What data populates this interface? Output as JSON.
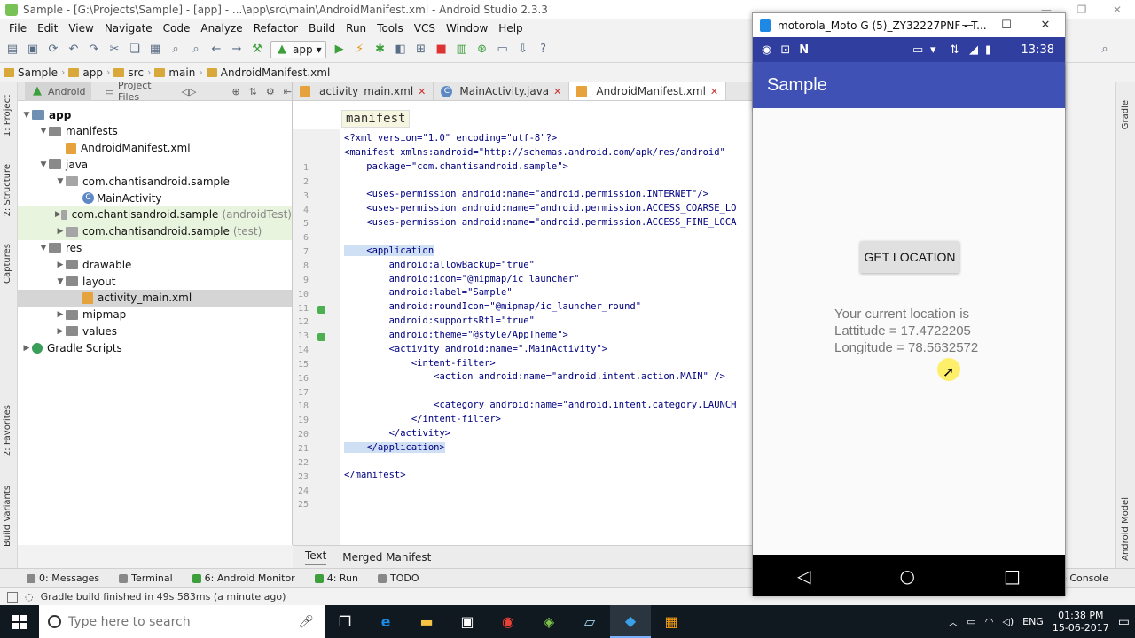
{
  "window": {
    "title": "Sample - [G:\\Projects\\Sample] - [app] - ...\\app\\src\\main\\AndroidManifest.xml - Android Studio 2.3.3"
  },
  "menu": [
    "File",
    "Edit",
    "View",
    "Navigate",
    "Code",
    "Analyze",
    "Refactor",
    "Build",
    "Run",
    "Tools",
    "VCS",
    "Window",
    "Help"
  ],
  "toolbar": {
    "run_config": "app"
  },
  "breadcrumb": [
    "Sample",
    "app",
    "src",
    "main",
    "AndroidManifest.xml"
  ],
  "project_panel": {
    "view_mode": "Android",
    "secondary": "Project Files",
    "tree": [
      {
        "label": "app",
        "level": 0,
        "type": "folder-blue",
        "expanded": true,
        "bold": true
      },
      {
        "label": "manifests",
        "level": 1,
        "type": "folder",
        "expanded": true
      },
      {
        "label": "AndroidManifest.xml",
        "level": 2,
        "type": "xml"
      },
      {
        "label": "java",
        "level": 1,
        "type": "folder",
        "expanded": true
      },
      {
        "label": "com.chantisandroid.sample",
        "level": 2,
        "type": "pkg",
        "expanded": true
      },
      {
        "label": "MainActivity",
        "level": 3,
        "type": "class"
      },
      {
        "label": "com.chantisandroid.sample",
        "suffix": "(androidTest)",
        "level": 2,
        "type": "pkg",
        "expanded": false,
        "hl": true
      },
      {
        "label": "com.chantisandroid.sample",
        "suffix": "(test)",
        "level": 2,
        "type": "pkg",
        "expanded": false,
        "hl": true
      },
      {
        "label": "res",
        "level": 1,
        "type": "folder",
        "expanded": true
      },
      {
        "label": "drawable",
        "level": 2,
        "type": "folder",
        "expanded": false
      },
      {
        "label": "layout",
        "level": 2,
        "type": "folder",
        "expanded": true
      },
      {
        "label": "activity_main.xml",
        "level": 3,
        "type": "xml",
        "selected": true
      },
      {
        "label": "mipmap",
        "level": 2,
        "type": "folder",
        "expanded": false
      },
      {
        "label": "values",
        "level": 2,
        "type": "folder",
        "expanded": false
      },
      {
        "label": "Gradle Scripts",
        "level": 0,
        "type": "gradle",
        "expanded": false
      }
    ]
  },
  "side_tools": {
    "left": [
      "1: Project",
      "2: Structure",
      "Captures",
      "2: Favorites",
      "Build Variants"
    ],
    "right": [
      "Gradle",
      "Android Model"
    ]
  },
  "editor": {
    "tabs": [
      {
        "label": "activity_main.xml",
        "active": false
      },
      {
        "label": "MainActivity.java",
        "active": false
      },
      {
        "label": "AndroidManifest.xml",
        "active": true
      }
    ],
    "breadcrumb_tag": "manifest",
    "lines": [
      "<?xml version=\"1.0\" encoding=\"utf-8\"?>",
      "<manifest xmlns:android=\"http://schemas.android.com/apk/res/android\"",
      "    package=\"com.chantisandroid.sample\">",
      "",
      "    <uses-permission android:name=\"android.permission.INTERNET\"/>",
      "    <uses-permission android:name=\"android.permission.ACCESS_COARSE_LO",
      "    <uses-permission android:name=\"android.permission.ACCESS_FINE_LOCA",
      "",
      "    <application",
      "        android:allowBackup=\"true\"",
      "        android:icon=\"@mipmap/ic_launcher\"",
      "        android:label=\"Sample\"",
      "        android:roundIcon=\"@mipmap/ic_launcher_round\"",
      "        android:supportsRtl=\"true\"",
      "        android:theme=\"@style/AppTheme\">",
      "        <activity android:name=\".MainActivity\">",
      "            <intent-filter>",
      "                <action android:name=\"android.intent.action.MAIN\" />",
      "",
      "                <category android:name=\"android.intent.category.LAUNCH",
      "            </intent-filter>",
      "        </activity>",
      "    </application>",
      "",
      "</manifest>"
    ],
    "bottom_tabs": [
      {
        "label": "Text",
        "active": true
      },
      {
        "label": "Merged Manifest",
        "active": false
      }
    ]
  },
  "tool_windows": [
    "0: Messages",
    "Terminal",
    "6: Android Monitor",
    "4: Run",
    "TODO"
  ],
  "status_bar": {
    "message": "Gradle build finished in 49s 583ms (a minute ago)"
  },
  "emulator": {
    "title": "motorola_Moto G (5)_ZY32227PNF - T...",
    "time": "13:38",
    "app_title": "Sample",
    "button": "GET LOCATION",
    "location_heading": "Your current location is",
    "latitude": "Lattitude = 17.4722205",
    "longitude": "Longitude = 78.5632572",
    "right_label": "e Console"
  },
  "taskbar": {
    "search_placeholder": "Type here to search",
    "apps": [
      "task-view",
      "edge",
      "file-explorer",
      "store",
      "chrome",
      "android-studio",
      "notepad",
      "vscode",
      "other"
    ],
    "lang": "ENG",
    "time": "01:38 PM",
    "date": "15-06-2017"
  },
  "colors": {
    "accent": "#3f51b5",
    "status": "#303f9f",
    "code_blue": "#000080"
  }
}
